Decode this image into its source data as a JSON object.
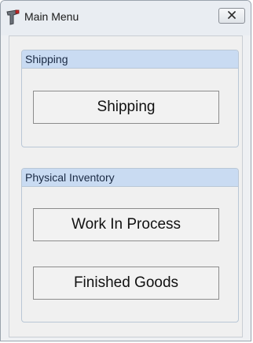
{
  "window": {
    "title": "Main Menu",
    "icon": "barcode-scanner-icon",
    "close_icon": "close-icon"
  },
  "groups": {
    "shipping": {
      "header": "Shipping",
      "buttons": {
        "shipping": "Shipping"
      }
    },
    "physical_inventory": {
      "header": "Physical Inventory",
      "buttons": {
        "work_in_process": "Work In Process",
        "finished_goods": "Finished Goods"
      }
    }
  },
  "colors": {
    "group_header_bg": "#c9dbf2",
    "client_bg": "#f0f0f0",
    "titlebar_bg": "#e9edf2"
  }
}
